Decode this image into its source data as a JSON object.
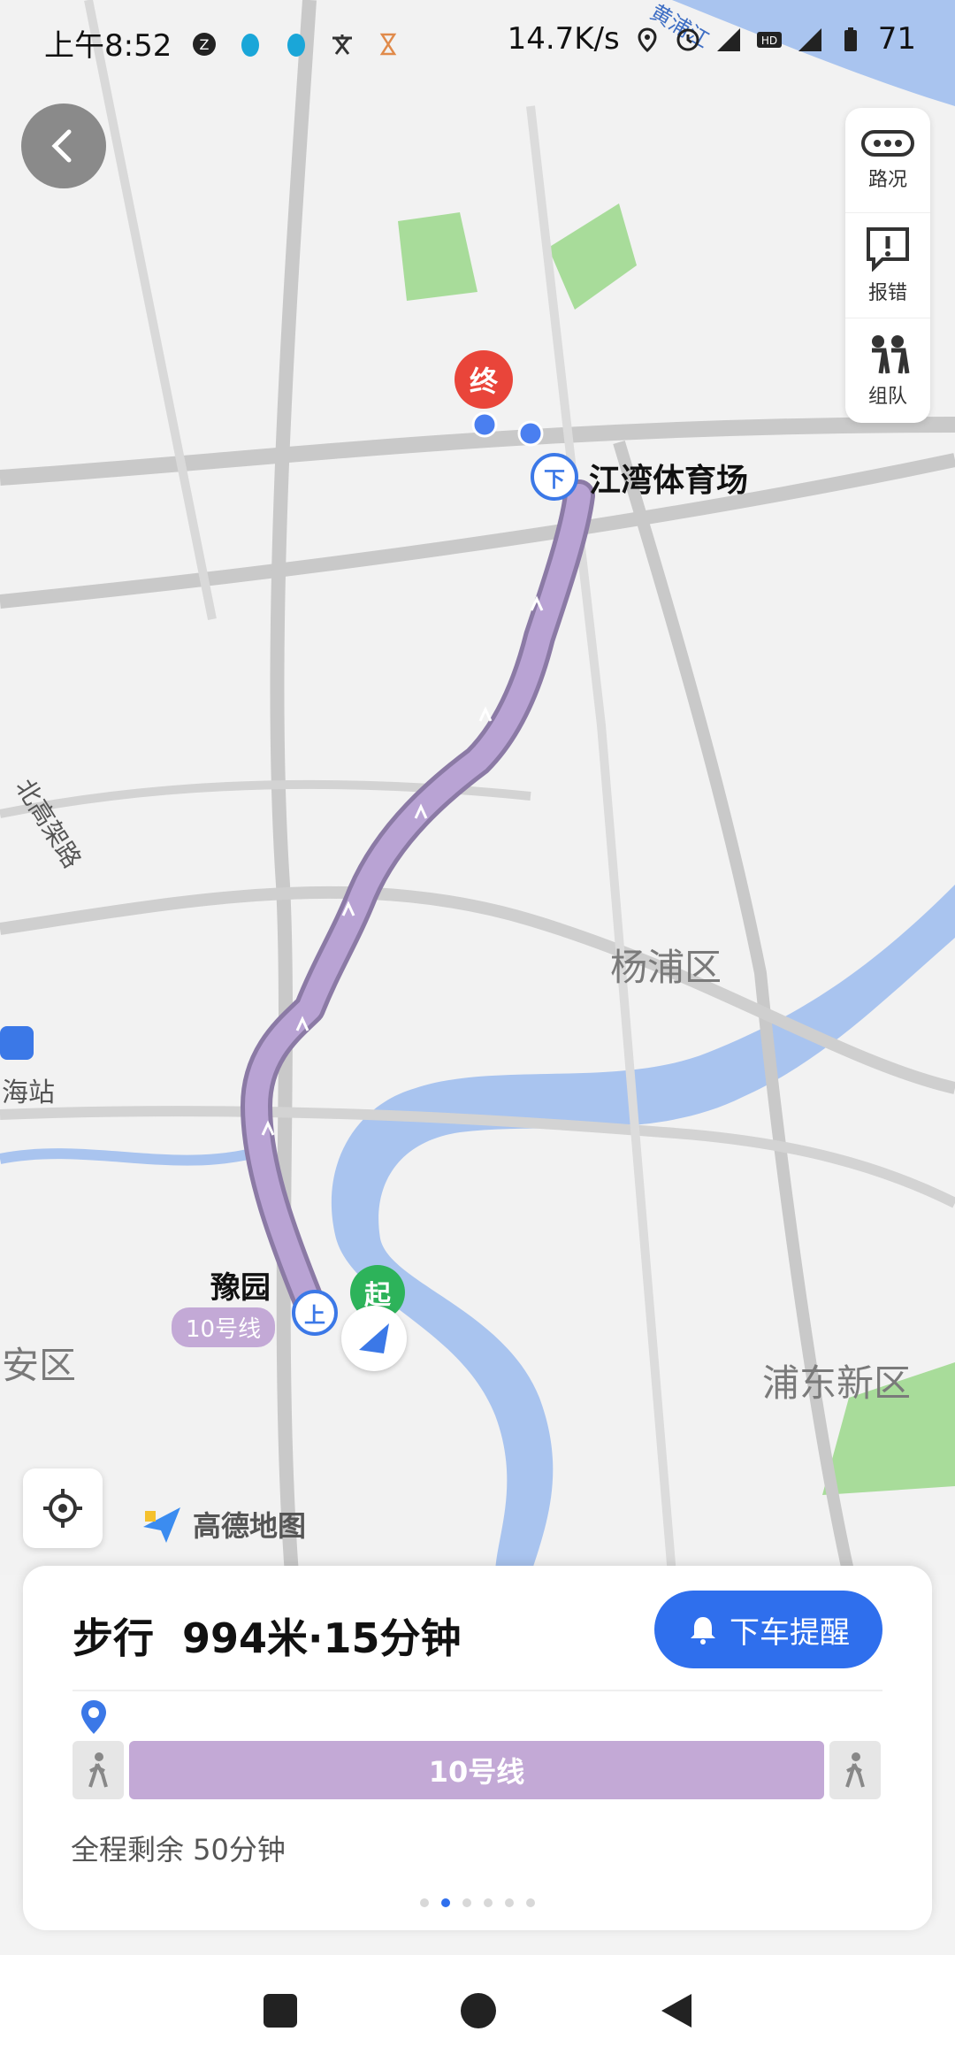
{
  "status": {
    "time": "上午8:52",
    "network": "14.7K/s",
    "battery": "71"
  },
  "map": {
    "destination_marker": "终",
    "start_marker": "起",
    "alight_marker": "下",
    "board_marker": "上",
    "alight_station": "江湾体育场",
    "board_station": "豫园",
    "board_line_badge": "10号线",
    "districts": [
      "杨浦区",
      "浦东新区",
      "安区"
    ],
    "river_label": "黄浦江",
    "road_label": "北高架路",
    "left_station": "海站",
    "route_color": "#b9a3d4"
  },
  "side_panel": {
    "traffic": "路况",
    "report": "报错",
    "team": "组队"
  },
  "logo": {
    "text": "高德地图"
  },
  "card": {
    "mode": "步行",
    "distance_time": "994米·15分钟",
    "alert_label": "下车提醒",
    "line_name": "10号线",
    "remaining": "全程剩余 50分钟",
    "page_dots": 6,
    "active_dot": 1
  }
}
